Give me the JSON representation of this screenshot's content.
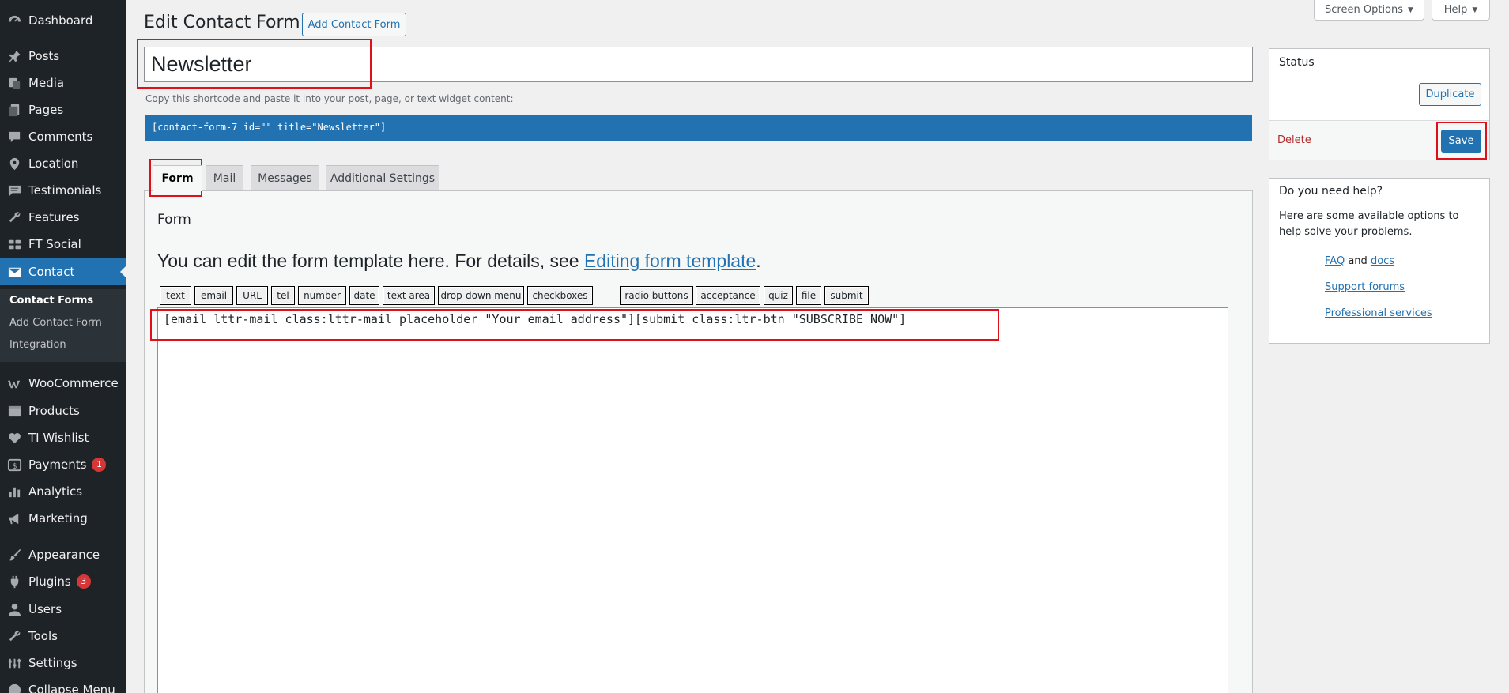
{
  "sidebar": {
    "items": [
      {
        "label": "Dashboard",
        "icon": "dashboard-icon"
      },
      {
        "label": "Posts",
        "icon": "pin-icon"
      },
      {
        "label": "Media",
        "icon": "media-icon"
      },
      {
        "label": "Pages",
        "icon": "pages-icon"
      },
      {
        "label": "Comments",
        "icon": "comment-icon"
      },
      {
        "label": "Location",
        "icon": "location-pin-icon"
      },
      {
        "label": "Testimonials",
        "icon": "testimonial-icon"
      },
      {
        "label": "Features",
        "icon": "wrench-icon"
      },
      {
        "label": "FT Social",
        "icon": "social-icon"
      },
      {
        "label": "Contact",
        "icon": "envelope-icon"
      },
      {
        "label": "WooCommerce",
        "icon": "woocommerce-icon"
      },
      {
        "label": "Products",
        "icon": "products-icon"
      },
      {
        "label": "TI Wishlist",
        "icon": "heart-icon"
      },
      {
        "label": "Payments",
        "icon": "payments-icon",
        "badge": "1"
      },
      {
        "label": "Analytics",
        "icon": "bar-chart-icon"
      },
      {
        "label": "Marketing",
        "icon": "megaphone-icon"
      },
      {
        "label": "Appearance",
        "icon": "brush-icon"
      },
      {
        "label": "Plugins",
        "icon": "plug-icon",
        "badge": "3"
      },
      {
        "label": "Users",
        "icon": "user-icon"
      },
      {
        "label": "Tools",
        "icon": "tools-icon"
      },
      {
        "label": "Settings",
        "icon": "settings-icon"
      },
      {
        "label": "Collapse Menu",
        "icon": "collapse-icon"
      }
    ],
    "submenu": [
      "Contact Forms",
      "Add Contact Form",
      "Integration"
    ]
  },
  "header": {
    "title": "Edit Contact Form",
    "add_button": "Add Contact Form",
    "screen_options": "Screen Options",
    "help": "Help"
  },
  "form": {
    "title_value": "Newsletter",
    "shortcode_hint": "Copy this shortcode and paste it into your post, page, or text widget content:",
    "shortcode": "[contact-form-7 id=\"\" title=\"Newsletter\"]",
    "tabs": [
      "Form",
      "Mail",
      "Messages",
      "Additional Settings"
    ],
    "panel_heading": "Form",
    "intro_text": "You can edit the form template here. For details, see ",
    "intro_link": "Editing form template",
    "intro_end": ".",
    "tag_buttons": [
      "text",
      "email",
      "URL",
      "tel",
      "number",
      "date",
      "text area",
      "drop-down menu",
      "checkboxes",
      "radio buttons",
      "acceptance",
      "quiz",
      "file",
      "submit"
    ],
    "template": "[email lttr-mail class:lttr-mail placeholder \"Your email address\"][submit class:ltr-btn \"SUBSCRIBE NOW\"]"
  },
  "status_box": {
    "title": "Status",
    "duplicate": "Duplicate",
    "delete": "Delete",
    "save": "Save"
  },
  "help_box": {
    "title": "Do you need help?",
    "text": "Here are some available options to help solve your problems.",
    "faq": "FAQ",
    "and": "and",
    "docs": "docs",
    "forums": "Support forums",
    "services": "Professional services"
  },
  "colors": {
    "sidebar_bg": "#1d2327",
    "accent": "#2271b1",
    "annotation": "#e0101a",
    "badge": "#d63638"
  }
}
